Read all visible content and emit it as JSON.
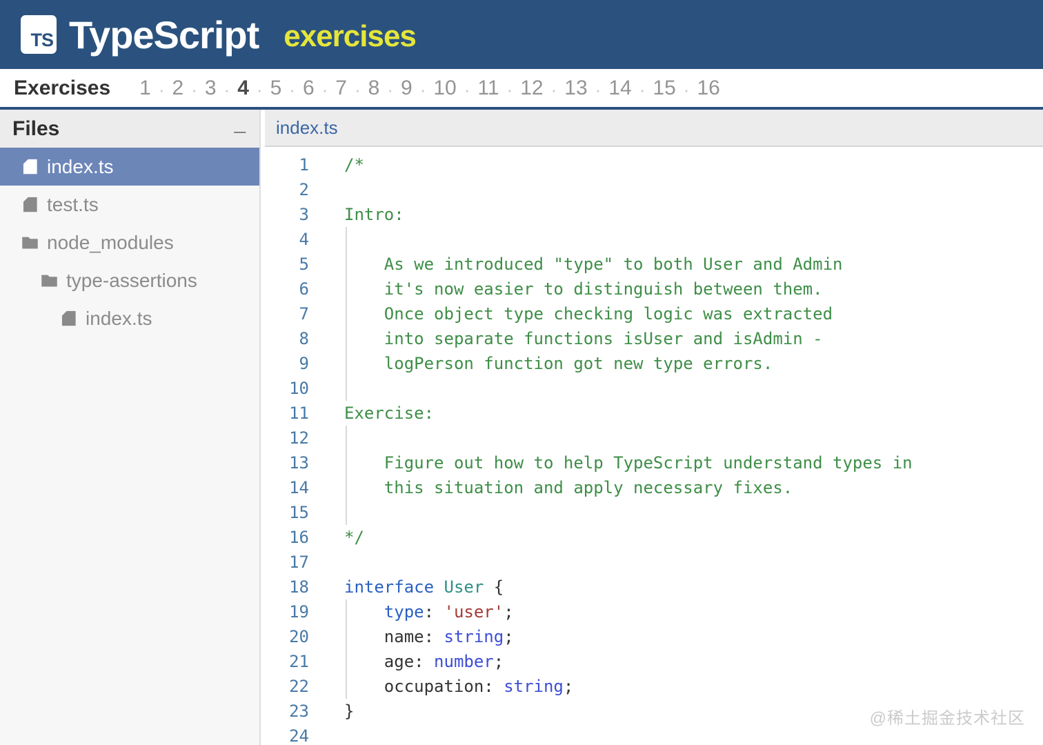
{
  "colors": {
    "header-bg": "#2b527e",
    "logo-bg": "#ffffff",
    "brand-yellow": "#e5e63a",
    "accent-border": "#2b527e",
    "nav-label": "#333333",
    "nav-num": "#949494",
    "nav-num-active": "#4d4d4d",
    "nav-dot": "#c6c6c6",
    "panel-bg": "#ececec",
    "sidebar-bg": "#f7f7f7",
    "divider": "#dedede",
    "selected-bg": "#6d86b8",
    "selected-text": "#ffffff",
    "tree-text": "#8b8b8b",
    "tree-icon": "#8a8a8a",
    "tab-text": "#3c66a4",
    "linenum": "#4879a6",
    "comment": "#3e8e47",
    "keyword": "#2a5fc2",
    "type": "#2f8f84",
    "builtin": "#3d4ed4",
    "string": "#a33c35",
    "plain": "#333333",
    "guide": "#d9d9d9",
    "watermark": "#cbcbcb"
  },
  "header": {
    "logo": "TS",
    "title": "TypeScript",
    "subtitle": "exercises"
  },
  "nav": {
    "label": "Exercises",
    "numbers": [
      "1",
      "2",
      "3",
      "4",
      "5",
      "6",
      "7",
      "8",
      "9",
      "10",
      "11",
      "12",
      "13",
      "14",
      "15",
      "16"
    ],
    "active": "4"
  },
  "sidebar": {
    "title": "Files",
    "minimize": "_",
    "items": [
      {
        "label": "index.ts",
        "icon": "file",
        "indent": 0,
        "selected": true
      },
      {
        "label": "test.ts",
        "icon": "file",
        "indent": 0,
        "selected": false
      },
      {
        "label": "node_modules",
        "icon": "folder",
        "indent": 0,
        "selected": false
      },
      {
        "label": "type-assertions",
        "icon": "folder",
        "indent": 1,
        "selected": false
      },
      {
        "label": "index.ts",
        "icon": "file",
        "indent": 2,
        "selected": false
      }
    ]
  },
  "editor": {
    "tab": "index.ts",
    "lines": [
      {
        "n": "1",
        "guide": false,
        "tokens": [
          [
            "comment",
            "/*"
          ]
        ]
      },
      {
        "n": "2",
        "guide": false,
        "tokens": []
      },
      {
        "n": "3",
        "guide": false,
        "tokens": [
          [
            "comment",
            "Intro:"
          ]
        ]
      },
      {
        "n": "4",
        "guide": true,
        "tokens": []
      },
      {
        "n": "5",
        "guide": true,
        "tokens": [
          [
            "comment",
            "    As we introduced \"type\" to both User and Admin"
          ]
        ]
      },
      {
        "n": "6",
        "guide": true,
        "tokens": [
          [
            "comment",
            "    it's now easier to distinguish between them."
          ]
        ]
      },
      {
        "n": "7",
        "guide": true,
        "tokens": [
          [
            "comment",
            "    Once object type checking logic was extracted"
          ]
        ]
      },
      {
        "n": "8",
        "guide": true,
        "tokens": [
          [
            "comment",
            "    into separate functions isUser and isAdmin -"
          ]
        ]
      },
      {
        "n": "9",
        "guide": true,
        "tokens": [
          [
            "comment",
            "    logPerson function got new type errors."
          ]
        ]
      },
      {
        "n": "10",
        "guide": true,
        "tokens": []
      },
      {
        "n": "11",
        "guide": false,
        "tokens": [
          [
            "comment",
            "Exercise:"
          ]
        ]
      },
      {
        "n": "12",
        "guide": true,
        "tokens": []
      },
      {
        "n": "13",
        "guide": true,
        "tokens": [
          [
            "comment",
            "    Figure out how to help TypeScript understand types in"
          ]
        ]
      },
      {
        "n": "14",
        "guide": true,
        "tokens": [
          [
            "comment",
            "    this situation and apply necessary fixes."
          ]
        ]
      },
      {
        "n": "15",
        "guide": true,
        "tokens": []
      },
      {
        "n": "16",
        "guide": false,
        "tokens": [
          [
            "comment",
            "*/"
          ]
        ]
      },
      {
        "n": "17",
        "guide": false,
        "tokens": []
      },
      {
        "n": "18",
        "guide": false,
        "tokens": [
          [
            "keyword",
            "interface"
          ],
          [
            "plain",
            " "
          ],
          [
            "type",
            "User"
          ],
          [
            "plain",
            " {"
          ]
        ]
      },
      {
        "n": "19",
        "guide": true,
        "tokens": [
          [
            "plain",
            "    "
          ],
          [
            "keyword",
            "type"
          ],
          [
            "plain",
            ": "
          ],
          [
            "string",
            "'user'"
          ],
          [
            "plain",
            ";"
          ]
        ]
      },
      {
        "n": "20",
        "guide": true,
        "tokens": [
          [
            "plain",
            "    name: "
          ],
          [
            "builtin",
            "string"
          ],
          [
            "plain",
            ";"
          ]
        ]
      },
      {
        "n": "21",
        "guide": true,
        "tokens": [
          [
            "plain",
            "    age: "
          ],
          [
            "builtin",
            "number"
          ],
          [
            "plain",
            ";"
          ]
        ]
      },
      {
        "n": "22",
        "guide": true,
        "tokens": [
          [
            "plain",
            "    occupation: "
          ],
          [
            "builtin",
            "string"
          ],
          [
            "plain",
            ";"
          ]
        ]
      },
      {
        "n": "23",
        "guide": false,
        "tokens": [
          [
            "plain",
            "}"
          ]
        ]
      },
      {
        "n": "24",
        "guide": false,
        "tokens": []
      }
    ]
  },
  "watermark": "@稀土掘金技术社区"
}
